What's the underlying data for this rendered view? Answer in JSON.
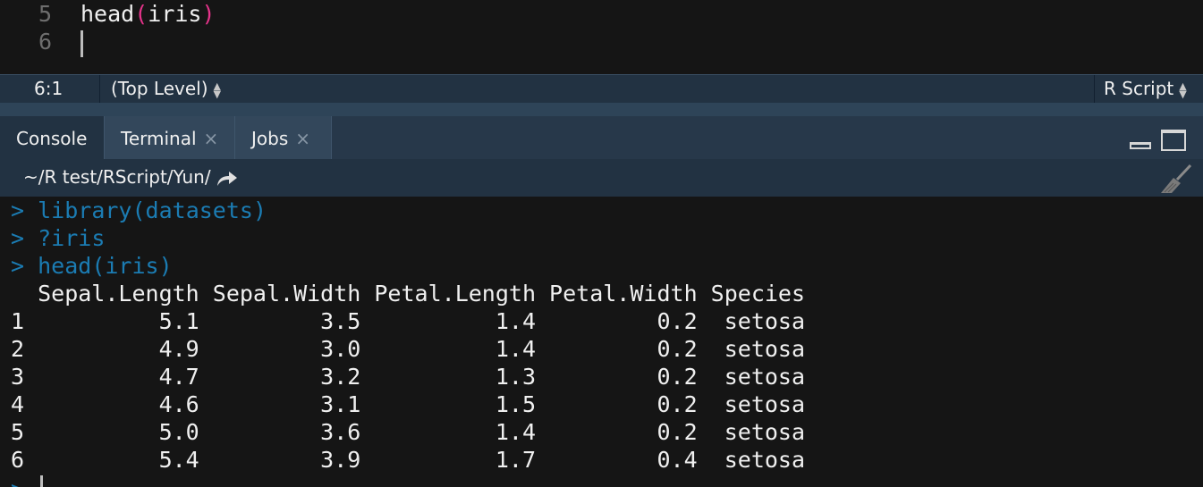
{
  "editor": {
    "lines": [
      {
        "number": "5",
        "code": "head",
        "open": "(",
        "arg": "iris",
        "close": ")"
      },
      {
        "number": "6",
        "code": ""
      }
    ]
  },
  "statusbar": {
    "cursor_position": "6:1",
    "scope": "(Top Level)",
    "file_type": "R Script"
  },
  "console_pane": {
    "tabs": [
      {
        "label": "Console",
        "active": true,
        "closable": false
      },
      {
        "label": "Terminal",
        "active": false,
        "closable": true
      },
      {
        "label": "Jobs",
        "active": false,
        "closable": true
      }
    ],
    "close_glyph": "×",
    "working_directory": "~/R test/RScript/Yun/",
    "icons": [
      "minimize-icon",
      "maximize-icon",
      "goto-directory-icon",
      "clear-console-broom-icon"
    ]
  },
  "console": {
    "prompt": ">",
    "commands": [
      "library(datasets)",
      "?iris",
      "head(iris)"
    ],
    "table": {
      "header": "  Sepal.Length Sepal.Width Petal.Length Petal.Width Species",
      "rows": [
        "1          5.1         3.5          1.4         0.2  setosa",
        "2          4.9         3.0          1.4         0.2  setosa",
        "3          4.7         3.2          1.3         0.2  setosa",
        "4          4.6         3.1          1.5         0.2  setosa",
        "5          5.0         3.6          1.4         0.2  setosa",
        "6          5.4         3.9          1.7         0.4  setosa"
      ]
    }
  },
  "colors": {
    "background": "#151515",
    "prompt_blue": "#1b7cb3",
    "paren_pink": "#e5338a",
    "pane_header": "#223242"
  }
}
